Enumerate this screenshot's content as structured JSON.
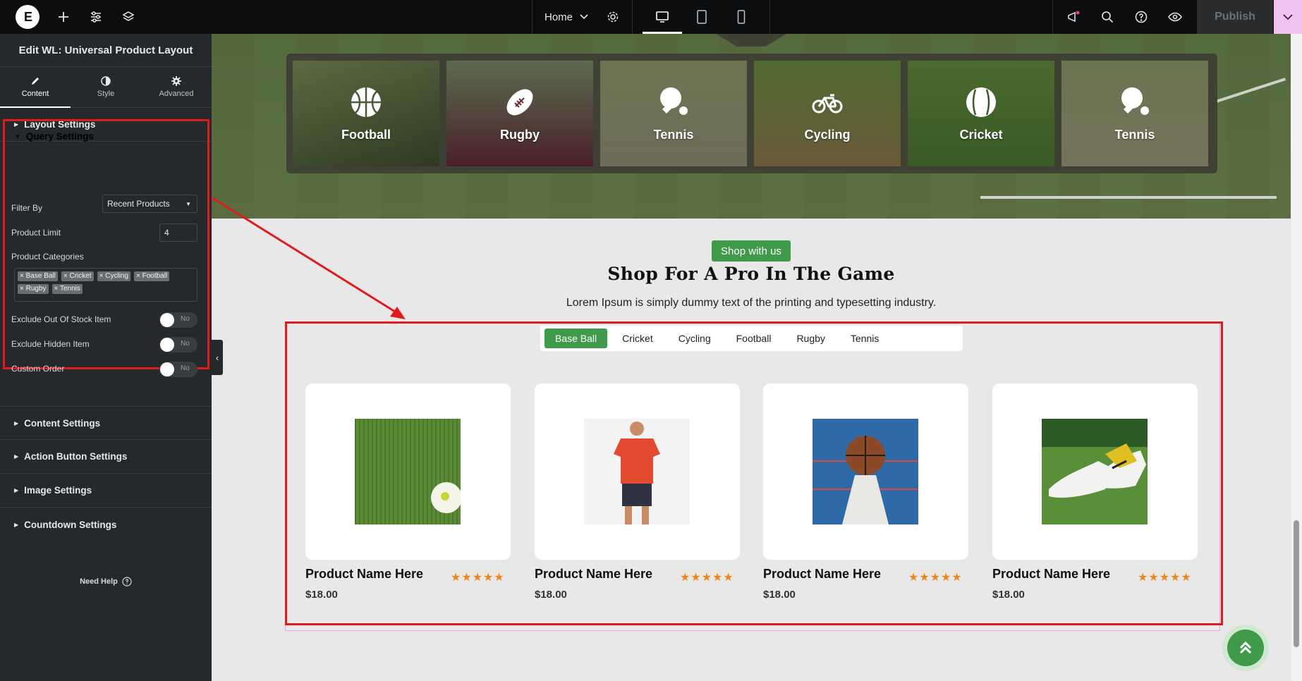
{
  "topbar": {
    "logo_label": "E",
    "page_select": "Home",
    "publish_label": "Publish"
  },
  "sidebar": {
    "title": "Edit WL: Universal Product Layout",
    "tabs": [
      {
        "label": "Content",
        "icon": "pencil-icon"
      },
      {
        "label": "Style",
        "icon": "half-circle-icon"
      },
      {
        "label": "Advanced",
        "icon": "gear-icon"
      }
    ],
    "sections": {
      "layout": "Layout Settings",
      "query": "Query Settings",
      "content": "Content Settings",
      "action_button": "Action Button Settings",
      "image": "Image Settings",
      "countdown": "Countdown Settings"
    },
    "query": {
      "filter_by_label": "Filter By",
      "filter_by_value": "Recent Products",
      "product_limit_label": "Product Limit",
      "product_limit_value": "4",
      "categories_label": "Product Categories",
      "categories": [
        "× Base Ball",
        "× Cricket",
        "× Cycling",
        "× Football",
        "× Rugby",
        "× Tennis"
      ],
      "exclude_out_of_stock_label": "Exclude Out Of Stock Item",
      "exclude_out_of_stock_value": "No",
      "exclude_hidden_label": "Exclude Hidden Item",
      "exclude_hidden_value": "No",
      "custom_order_label": "Custom Order",
      "custom_order_value": "No"
    },
    "need_help": "Need Help"
  },
  "hero": {
    "categories": [
      {
        "label": "Football",
        "icon": "basketball-icon"
      },
      {
        "label": "Rugby",
        "icon": "rugby-ball-icon"
      },
      {
        "label": "Tennis",
        "icon": "table-tennis-icon"
      },
      {
        "label": "Cycling",
        "icon": "bicycle-icon"
      },
      {
        "label": "Cricket",
        "icon": "cricket-ball-icon"
      },
      {
        "label": "Tennis",
        "icon": "table-tennis-icon"
      }
    ]
  },
  "section": {
    "badge": "Shop with us",
    "heading": "Shop For A Pro In The Game",
    "subtitle": "Lorem Ipsum is simply dummy text of the printing and typesetting industry."
  },
  "product_tabs": [
    "Base Ball",
    "Cricket",
    "Cycling",
    "Football",
    "Rugby",
    "Tennis"
  ],
  "products": [
    {
      "name": "Product Name Here",
      "price": "$18.00",
      "rating": "★★★★★",
      "image": "soccer-ball-on-grass"
    },
    {
      "name": "Product Name Here",
      "price": "$18.00",
      "rating": "★★★★★",
      "image": "man-red-tshirt"
    },
    {
      "name": "Product Name Here",
      "price": "$18.00",
      "rating": "★★★★★",
      "image": "basketball-on-cone"
    },
    {
      "name": "Product Name Here",
      "price": "$18.00",
      "rating": "★★★★★",
      "image": "football-boots-on-grass"
    }
  ],
  "colors": {
    "accent_green": "#3f9a4a",
    "highlight_red": "#e01b1b",
    "star_orange": "#f0861b",
    "sidebar_bg": "#26292c",
    "topbar_bg": "#0c0d0e"
  }
}
